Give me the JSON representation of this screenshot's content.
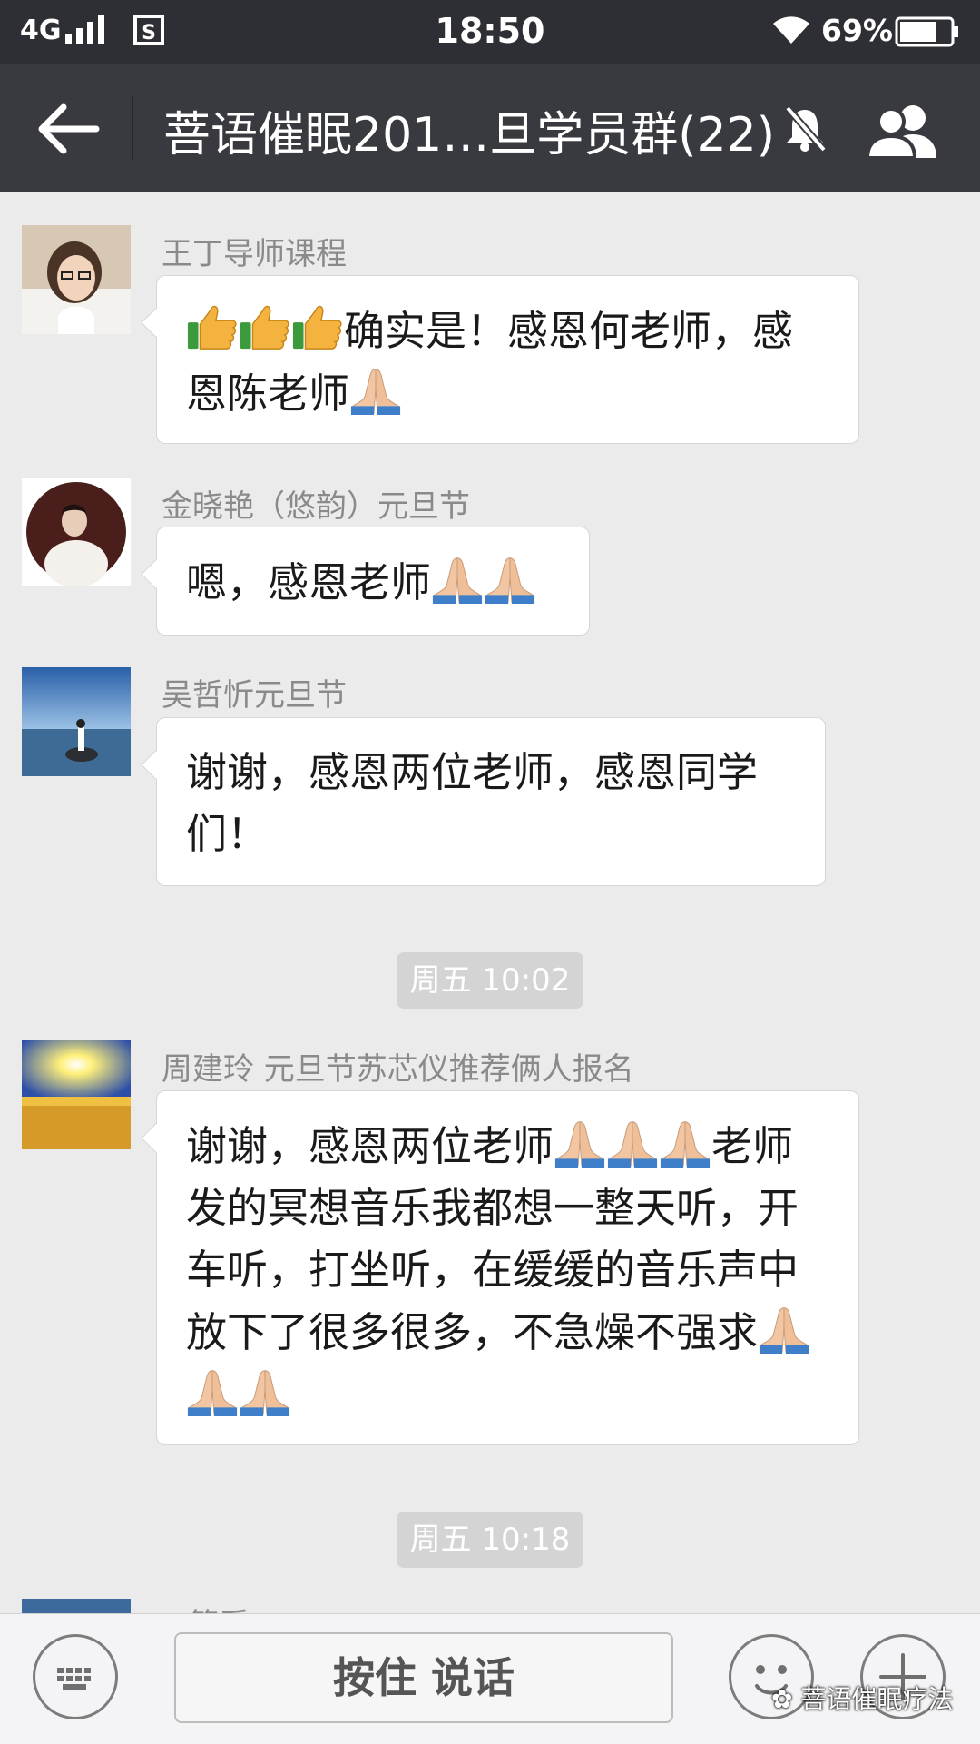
{
  "status_bar": {
    "network": "4G",
    "time": "18:50",
    "battery": "69%",
    "icons": [
      "signal-icon",
      "sim-icon",
      "wifi-icon",
      "battery-icon"
    ]
  },
  "header": {
    "title": "菩语催眠201…旦学员群(22)",
    "icons": [
      "back-arrow-icon",
      "mute-bell-icon",
      "group-members-icon"
    ]
  },
  "messages": [
    {
      "sender": "王丁导师课程",
      "line1": "确实是！感恩何老师，感",
      "line2": "恩陈老师"
    },
    {
      "sender": "金晓艳（悠韵）元旦节",
      "line1": "嗯，感恩老师"
    },
    {
      "sender": "吴哲忻元旦节",
      "line1": "谢谢，感恩两位老师，感恩同学",
      "line2": "们！"
    },
    {
      "timestamp": "周五 10:02"
    },
    {
      "sender": "周建玲 元旦节苏芯仪推荐俩人报名",
      "line1": "谢谢，感恩两位老师",
      "line1b": "老师",
      "line2": "发的冥想音乐我都想一整天听，开",
      "line3": "车听，打坐听，在缓缓的音乐声中",
      "line4": "放下了很多很多，不急燥不强求"
    },
    {
      "timestamp": "周五 10:18"
    },
    {
      "sender": "○简采"
    }
  ],
  "emoji": {
    "thumbs_up": "thumbs-up-emoji",
    "pray": "folded-hands-emoji"
  },
  "input_bar": {
    "voice_label": "按住 说话",
    "icons": [
      "keyboard-icon",
      "emoji-face-icon",
      "plus-icon"
    ]
  },
  "watermark": "菩语催眠疗法",
  "colors": {
    "status_bar": "#2e2f34",
    "title_bar": "#393a3f",
    "chat_bg": "#ebebeb",
    "timestamp_bg": "#d4d4d4"
  }
}
